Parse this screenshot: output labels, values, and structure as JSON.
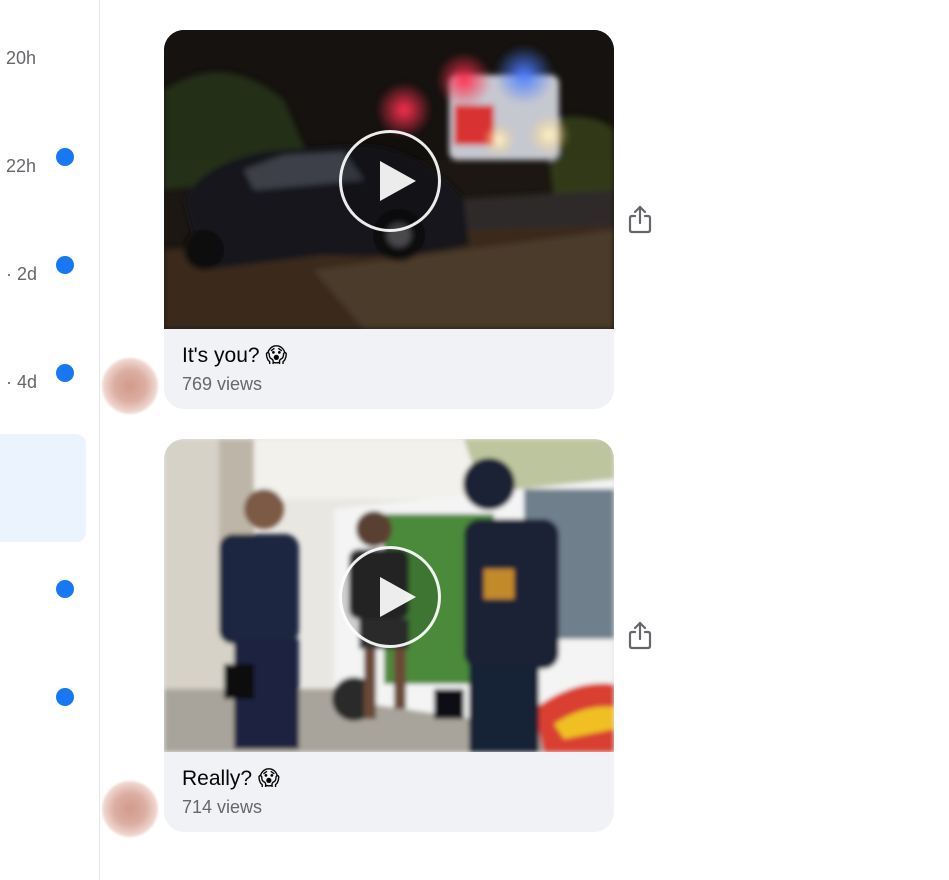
{
  "sidebar": {
    "rows": [
      {
        "time": "20h",
        "unread": false,
        "selected": false
      },
      {
        "time": "22h",
        "unread": true,
        "selected": false
      },
      {
        "time": "· 2d",
        "unread": true,
        "selected": false
      },
      {
        "time": "· 4d",
        "unread": true,
        "selected": false
      },
      {
        "time": "",
        "unread": false,
        "selected": true
      },
      {
        "time": "",
        "unread": true,
        "selected": false
      },
      {
        "time": "",
        "unread": true,
        "selected": false
      }
    ]
  },
  "messages": [
    {
      "thumbnail_icon": "video-thumbnail-night-accident",
      "caption": "It's you? 😱",
      "views": "769 views",
      "share_icon": "share-icon"
    },
    {
      "thumbnail_icon": "video-thumbnail-police-van",
      "caption": "Really? 😱",
      "views": "714 views",
      "share_icon": "share-icon"
    }
  ],
  "colors": {
    "unread_dot": "#1877f2",
    "selected_row": "#ebf3ff",
    "card_bg": "#f0f2f5",
    "secondary_text": "#65676b"
  }
}
